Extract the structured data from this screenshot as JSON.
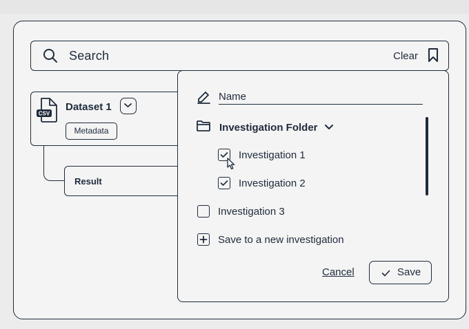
{
  "search": {
    "placeholder": "Search",
    "clear_label": "Clear",
    "search_icon": "search-icon",
    "bookmark_icon": "bookmark-icon"
  },
  "dataset": {
    "file_badge": "CSV",
    "title": "Dataset 1",
    "metadata_label": "Metadata"
  },
  "result": {
    "label": "Result"
  },
  "popup": {
    "name_placeholder": "Name",
    "folder": {
      "label": "Investigation Folder",
      "expanded": true
    },
    "investigations": [
      {
        "label": "Investigation 1",
        "checked": true
      },
      {
        "label": "Investigation 2",
        "checked": true
      },
      {
        "label": "Investigation 3",
        "checked": false
      }
    ],
    "save_new_label": "Save to a new investigation",
    "cancel_label": "Cancel",
    "save_label": "Save"
  },
  "colors": {
    "ink": "#1e2a3b",
    "surface": "#f4f4f4",
    "background": "#ececec"
  }
}
